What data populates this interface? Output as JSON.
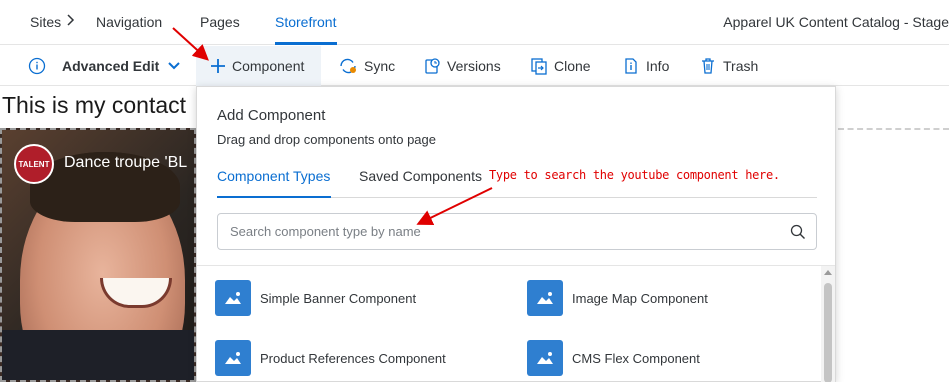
{
  "topnav": {
    "sites": "Sites",
    "navigation": "Navigation",
    "pages": "Pages",
    "storefront": "Storefront",
    "catalog": "Apparel UK Content Catalog - Stage"
  },
  "toolbar": {
    "advanced_edit": "Advanced Edit",
    "component": "Component",
    "sync": "Sync",
    "versions": "Versions",
    "clone": "Clone",
    "info": "Info",
    "trash": "Trash"
  },
  "page": {
    "heading": "This is my contact",
    "video_title": "Dance troupe 'BL",
    "video_logo": "TALENT"
  },
  "popover": {
    "title": "Add Component",
    "subtitle": "Drag and drop components onto page",
    "tabs": [
      "Component Types",
      "Saved Components"
    ],
    "search_placeholder": "Search component type by name",
    "components": [
      "Simple Banner Component",
      "Image Map Component",
      "Product References Component",
      "CMS Flex Component"
    ]
  },
  "annotation": {
    "note": "Type to search the youtube component here.",
    "color": "#e00000"
  },
  "colors": {
    "accent": "#0a6ed1",
    "component_icon": "#2f7fd0"
  }
}
